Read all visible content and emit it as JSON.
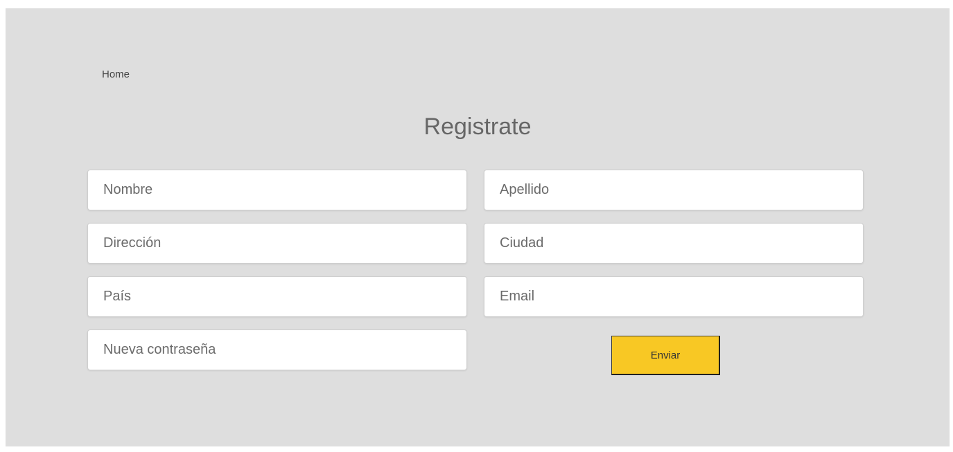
{
  "nav": {
    "home_label": "Home"
  },
  "form": {
    "title": "Registrate",
    "fields": {
      "nombre": {
        "placeholder": "Nombre",
        "value": ""
      },
      "apellido": {
        "placeholder": "Apellido",
        "value": ""
      },
      "direccion": {
        "placeholder": "Dirección",
        "value": ""
      },
      "ciudad": {
        "placeholder": "Ciudad",
        "value": ""
      },
      "pais": {
        "placeholder": "País",
        "value": ""
      },
      "email": {
        "placeholder": "Email",
        "value": ""
      },
      "password": {
        "placeholder": "Nueva contraseña",
        "value": ""
      }
    },
    "submit_label": "Enviar"
  },
  "colors": {
    "background": "#dedede",
    "accent": "#f8c824",
    "title_text": "#666666"
  }
}
